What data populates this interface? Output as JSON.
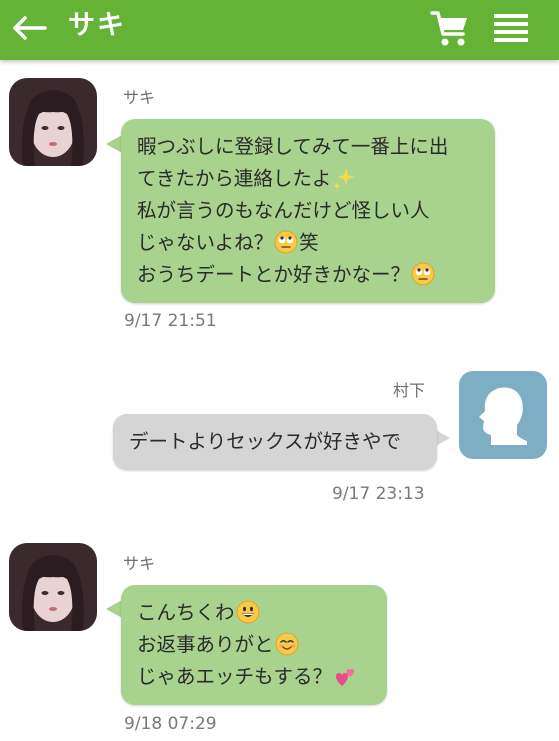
{
  "header": {
    "title": "サキ",
    "back_icon": "back-arrow-icon",
    "cart_icon": "cart-icon",
    "menu_icon": "menu-icon",
    "background": "#65b336"
  },
  "messages": [
    {
      "sender": "サキ",
      "side": "left",
      "lines": [
        "暇つぶしに登録してみて一番上に出",
        "てきたから連絡したよ",
        "私が言うのもなんだけど怪しい人",
        "じゃないよね？",
        "笑",
        "おうちデートとか好きかなー？"
      ],
      "time": "9/17 21:51"
    },
    {
      "sender": "村下",
      "side": "right",
      "lines": [
        "デートよりセックスが好きやで"
      ],
      "time": "9/17 23:13"
    },
    {
      "sender": "サキ",
      "side": "left",
      "lines": [
        "こんちくわ",
        "お返事ありがと",
        "じゃあエッチもする？"
      ],
      "time": "9/18 07:29"
    }
  ],
  "colors": {
    "bubble_incoming": "#a8d38e",
    "bubble_outgoing": "#d5d5d5",
    "silhouette_avatar": "#7eaec4"
  }
}
